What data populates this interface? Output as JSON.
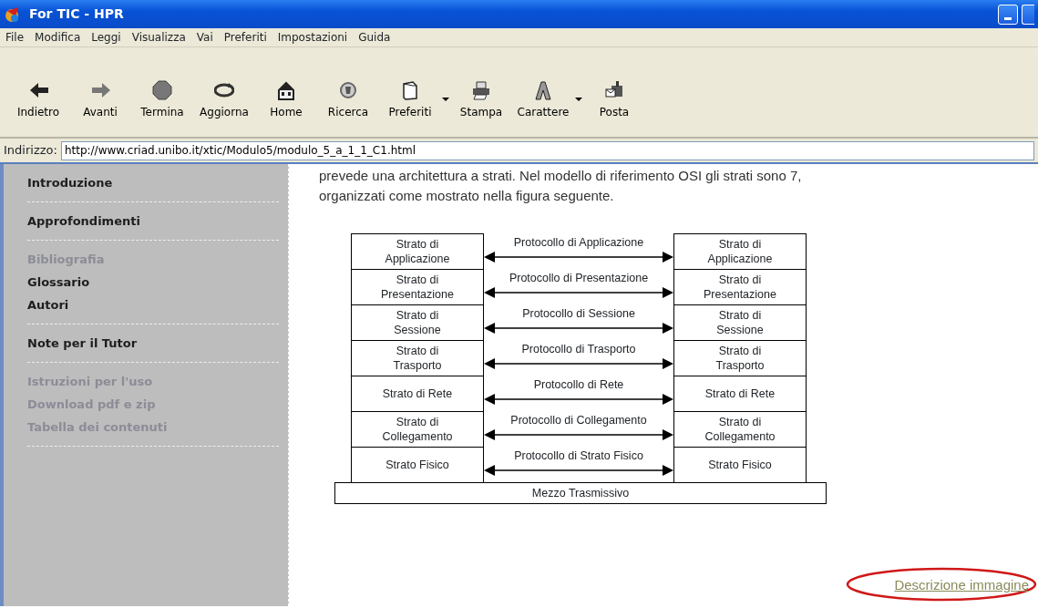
{
  "window": {
    "title": "For TIC - HPR"
  },
  "menu": [
    "File",
    "Modifica",
    "Leggi",
    "Visualizza",
    "Vai",
    "Preferiti",
    "Impostazioni",
    "Guida"
  ],
  "toolbar": [
    {
      "label": "Indietro",
      "dropdown": false
    },
    {
      "label": "Avanti",
      "dropdown": false
    },
    {
      "label": "Termina",
      "dropdown": false
    },
    {
      "label": "Aggiorna",
      "dropdown": false
    },
    {
      "label": "Home",
      "dropdown": false
    },
    {
      "label": "Ricerca",
      "dropdown": false
    },
    {
      "label": "Preferiti",
      "dropdown": true
    },
    {
      "label": "Stampa",
      "dropdown": false
    },
    {
      "label": "Carattere",
      "dropdown": true
    },
    {
      "label": "Posta",
      "dropdown": false
    }
  ],
  "address": {
    "label": "Indirizzo:",
    "value": "http://www.criad.unibo.it/xtic/Modulo5/modulo_5_a_1_1_C1.html"
  },
  "sidebar": {
    "groups": [
      {
        "items": [
          {
            "label": "Introduzione",
            "disabled": false
          }
        ]
      },
      {
        "items": [
          {
            "label": "Approfondimenti",
            "disabled": false
          }
        ]
      },
      {
        "items": [
          {
            "label": "Bibliografia",
            "disabled": true
          },
          {
            "label": "Glossario",
            "disabled": false
          },
          {
            "label": "Autori",
            "disabled": false
          }
        ]
      },
      {
        "items": [
          {
            "label": "Note per il Tutor",
            "disabled": false
          }
        ]
      },
      {
        "items": [
          {
            "label": "Istruzioni per l'uso",
            "disabled": true
          },
          {
            "label": "Download pdf e zip",
            "disabled": true
          },
          {
            "label": "Tabella dei contenuti",
            "disabled": true
          }
        ]
      }
    ]
  },
  "content": {
    "paragraph_lines": [
      "prevede una architettura a strati. Nel modello di riferimento OSI gli strati sono 7,",
      "organizzati come mostrato nella figura seguente."
    ],
    "diagram": {
      "layers": [
        {
          "left": "Strato di\nApplicazione",
          "protocol": "Protocollo di Applicazione",
          "right": "Strato di\nApplicazione"
        },
        {
          "left": "Strato di\nPresentazione",
          "protocol": "Protocollo di Presentazione",
          "right": "Strato di\nPresentazione"
        },
        {
          "left": "Strato di\nSessione",
          "protocol": "Protocollo di Sessione",
          "right": "Strato di\nSessione"
        },
        {
          "left": "Strato di\nTrasporto",
          "protocol": "Protocollo di Trasporto",
          "right": "Strato di\nTrasporto"
        },
        {
          "left": "Strato di Rete",
          "protocol": "Protocollo di Rete",
          "right": "Strato di Rete"
        },
        {
          "left": "Strato di\nCollegamento",
          "protocol": "Protocollo di Collegamento",
          "right": "Strato di\nCollegamento"
        },
        {
          "left": "Strato Fisico",
          "protocol": "Protocollo di Strato Fisico",
          "right": "Strato Fisico"
        }
      ],
      "medium": "Mezzo Trasmissivo"
    },
    "description_link": "Descrizione immagine"
  }
}
